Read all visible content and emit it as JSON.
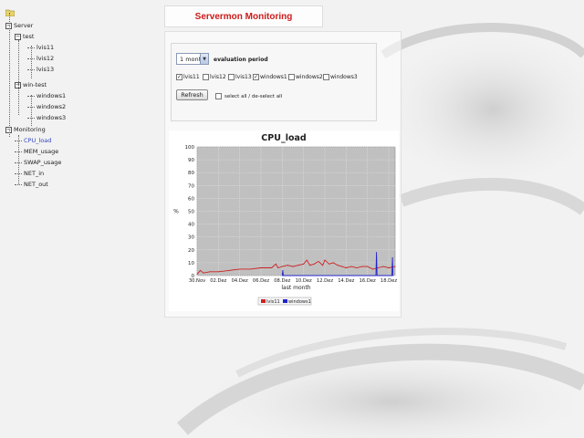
{
  "colors": {
    "title": "#cc1a1a",
    "link": "#3344bb",
    "plot_bg": "#c0c0c0",
    "series1": "#cc2222",
    "series2": "#2222cc"
  },
  "tree": {
    "root_icon": "folder-icon",
    "items": [
      {
        "id": "server",
        "label": "Server",
        "level": 0,
        "expander": "−"
      },
      {
        "id": "test",
        "label": "test",
        "level": 1,
        "expander": "−"
      },
      {
        "id": "lvis11",
        "label": "lvis11",
        "level": 2
      },
      {
        "id": "lvis12",
        "label": "lvis12",
        "level": 2
      },
      {
        "id": "lvis13",
        "label": "lvis13",
        "level": 2
      },
      {
        "id": "win-test",
        "label": "win-test",
        "level": 1,
        "expander": "−"
      },
      {
        "id": "windows1",
        "label": "windows1",
        "level": 2
      },
      {
        "id": "windows2",
        "label": "windows2",
        "level": 2
      },
      {
        "id": "windows3",
        "label": "windows3",
        "level": 2
      },
      {
        "id": "monitoring",
        "label": "Monitoring",
        "level": 0,
        "expander": "−"
      },
      {
        "id": "cpu-load",
        "label": "CPU_load",
        "level": 1,
        "selected": true
      },
      {
        "id": "mem-usage",
        "label": "MEM_usage",
        "level": 1
      },
      {
        "id": "swap-usage",
        "label": "SWAP_usage",
        "level": 1
      },
      {
        "id": "net-in",
        "label": "NET_in",
        "level": 1
      },
      {
        "id": "net-out",
        "label": "NET_out",
        "level": 1
      }
    ]
  },
  "header": {
    "title": "Servermon Monitoring"
  },
  "controls": {
    "period_value": "1 month",
    "period_label": "evaluation period",
    "hosts": [
      {
        "label": "lvis11",
        "checked": true
      },
      {
        "label": "lvis12",
        "checked": false
      },
      {
        "label": "lvis13",
        "checked": false
      },
      {
        "label": "windows1",
        "checked": true
      },
      {
        "label": "windows2",
        "checked": false
      },
      {
        "label": "windows3",
        "checked": false
      }
    ],
    "refresh_label": "Refresh",
    "select_all_label": "select all / de-select all"
  },
  "chart_data": {
    "type": "line",
    "title": "CPU_load",
    "xlabel": "last month",
    "ylabel": "%",
    "ylim": [
      0,
      100
    ],
    "yticks": [
      0,
      10,
      20,
      30,
      40,
      50,
      60,
      70,
      80,
      90,
      100
    ],
    "xticks": [
      "30.Nov",
      "02.Dez",
      "04.Dez",
      "06.Dez",
      "08.Dez",
      "10.Dez",
      "12.Dez",
      "14.Dez",
      "16.Dez",
      "18.Dez"
    ],
    "grid": true,
    "legend_position": "bottom",
    "series": [
      {
        "name": "lvis11",
        "color": "#cc2222",
        "x": [
          0,
          0.3,
          0.6,
          1.2,
          2.0,
          3.0,
          4.0,
          5.0,
          6.0,
          7.0,
          7.4,
          7.6,
          8.0,
          8.5,
          9.0,
          9.5,
          10.0,
          10.3,
          10.6,
          11.0,
          11.4,
          11.8,
          12.0,
          12.4,
          12.8,
          13.2,
          13.6,
          14.0,
          14.5,
          15.0,
          15.5,
          16.0,
          16.5,
          17.0,
          17.5,
          18.0,
          18.6
        ],
        "y": [
          1,
          4,
          2,
          3,
          3,
          4,
          5,
          5,
          6,
          6,
          9,
          6,
          7,
          8,
          7,
          8,
          9,
          12,
          8,
          9,
          11,
          8,
          12,
          9,
          10,
          8,
          7,
          6,
          7,
          6,
          7,
          7,
          5,
          6,
          7,
          6,
          7
        ]
      },
      {
        "name": "windows1",
        "color": "#2222cc",
        "x": [
          8.0,
          8.05,
          8.1,
          16.8,
          16.85,
          16.9,
          18.3,
          18.35,
          18.4
        ],
        "y": [
          0,
          4,
          0,
          0,
          18,
          0,
          0,
          14,
          0
        ]
      }
    ]
  }
}
